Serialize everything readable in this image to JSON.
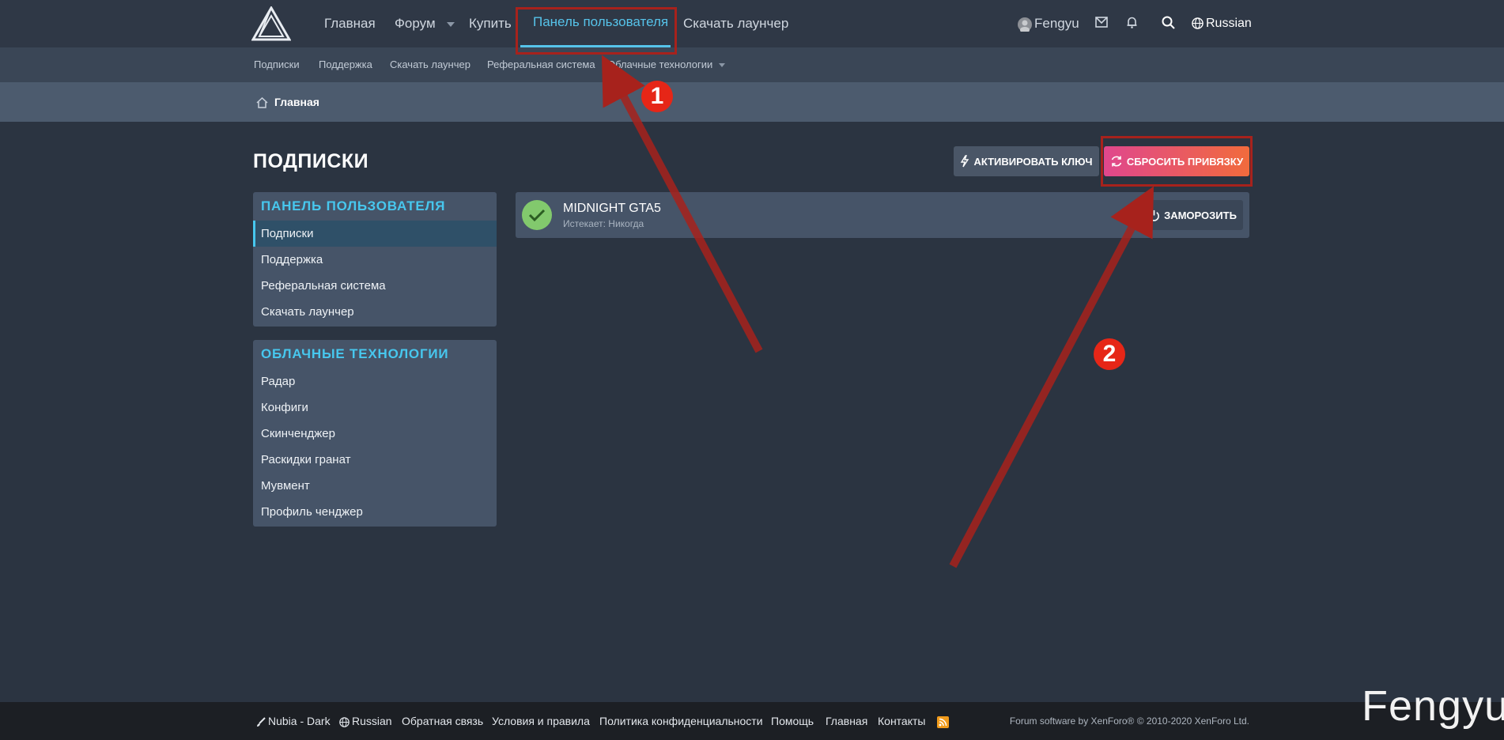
{
  "topnav": {
    "items": [
      "Главная",
      "Форум",
      "Купить",
      "Панель пользователя",
      "Скачать лаунчер"
    ],
    "user": "Fengyu",
    "language": "Russian"
  },
  "subnav": {
    "items": [
      "Подписки",
      "Поддержка",
      "Скачать лаунчер",
      "Реферальная система",
      "Облачные технологии"
    ]
  },
  "breadcrumb": {
    "home": "Главная"
  },
  "page": {
    "title": "ПОДПИСКИ"
  },
  "actions": {
    "activate_key": "АКТИВИРОВАТЬ КЛЮЧ",
    "reset_binding": "СБРОСИТЬ ПРИВЯЗКУ"
  },
  "sidebar": {
    "user_panel": {
      "title": "ПАНЕЛЬ ПОЛЬЗОВАТЕЛЯ",
      "items": [
        "Подписки",
        "Поддержка",
        "Реферальная система",
        "Скачать лаунчер"
      ]
    },
    "cloud": {
      "title": "ОБЛАЧНЫЕ ТЕХНОЛОГИИ",
      "items": [
        "Радар",
        "Конфиги",
        "Скинченджер",
        "Раскидки гранат",
        "Мувмент",
        "Профиль ченджер"
      ]
    }
  },
  "subscription": {
    "name": "MIDNIGHT GTA5",
    "expires": "Истекает: Никогда",
    "freeze": "ЗАМОРОЗИТЬ"
  },
  "footer": {
    "style": "Nubia - Dark",
    "language": "Russian",
    "links": [
      "Обратная связь",
      "Условия и правила",
      "Политика конфиденциальности",
      "Помощь",
      "Главная",
      "Контакты"
    ],
    "copyright": "Forum software by XenForo® © 2010-2020 XenForo Ltd."
  },
  "annotations": {
    "badge1": "1",
    "badge2": "2"
  },
  "watermark": "Fengyu",
  "colors": {
    "accent": "#47c7ee",
    "reset_gradient_start": "#e0478d",
    "reset_gradient_end": "#f16b3c",
    "annotation": "#a7221c"
  },
  "icons": [
    "logo-triangle-icon",
    "mail-icon",
    "bell-icon",
    "search-icon",
    "globe-icon",
    "home-icon",
    "bolt-icon",
    "refresh-icon",
    "check-icon",
    "power-icon",
    "brush-icon",
    "rss-icon"
  ]
}
